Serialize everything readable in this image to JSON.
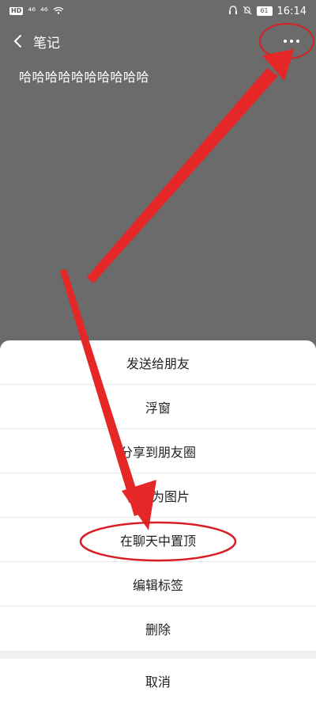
{
  "status_bar": {
    "left_badges": [
      "HD",
      "⁴⁶",
      "⁴⁶"
    ],
    "battery": "61",
    "time": "16:14"
  },
  "header": {
    "title": "笔记"
  },
  "note": {
    "content": "哈哈哈哈哈哈哈哈哈哈"
  },
  "menu": {
    "items": [
      "发送给朋友",
      "浮窗",
      "分享到朋友圈",
      "保存为图片",
      "在聊天中置顶",
      "编辑标签",
      "删除"
    ],
    "cancel": "取消"
  },
  "annotations": {
    "arrow_color": "#e52727",
    "highlight_color": "#d81f26"
  },
  "icons": {
    "back": "chevron-left-icon",
    "more": "more-dots-icon",
    "wifi": "wifi-icon",
    "mute": "bell-off-icon",
    "headset": "headset-icon"
  }
}
